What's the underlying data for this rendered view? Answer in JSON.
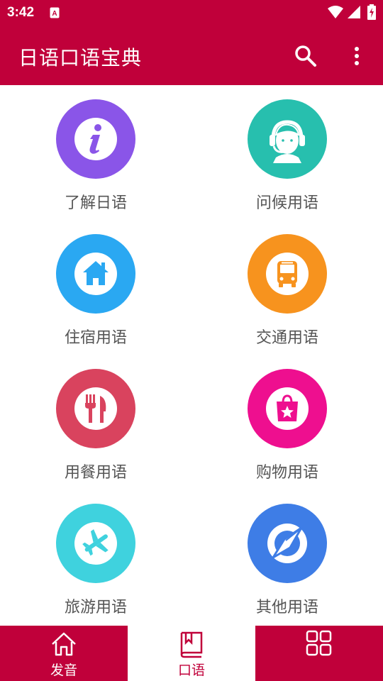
{
  "status_bar": {
    "time": "3:42",
    "icons": [
      "notification-a-icon",
      "wifi-icon",
      "signal-icon",
      "battery-charging-icon"
    ]
  },
  "app_bar": {
    "title": "日语口语宝典",
    "actions": [
      "search-icon",
      "more-vert-icon"
    ]
  },
  "categories": [
    {
      "label": "了解日语",
      "icon": "info-icon",
      "color": "#8a55e8"
    },
    {
      "label": "问候用语",
      "icon": "headset-operator-icon",
      "color": "#27bfae"
    },
    {
      "label": "住宿用语",
      "icon": "home-icon",
      "color": "#2aa8f2"
    },
    {
      "label": "交通用语",
      "icon": "bus-icon",
      "color": "#f7931e"
    },
    {
      "label": "用餐用语",
      "icon": "fork-knife-icon",
      "color": "#d9435e"
    },
    {
      "label": "购物用语",
      "icon": "shopping-bag-icon",
      "color": "#ee0f8f"
    },
    {
      "label": "旅游用语",
      "icon": "airplane-icon",
      "color": "#3fd2de"
    },
    {
      "label": "其他用语",
      "icon": "compass-icon",
      "color": "#3e7de6"
    }
  ],
  "bottom_nav": {
    "items": [
      {
        "label": "发音",
        "icon": "home-outline-icon",
        "selected": false
      },
      {
        "label": "口语",
        "icon": "book-icon",
        "selected": true
      },
      {
        "label": "",
        "icon": "grid-icon",
        "selected": false
      }
    ],
    "accent": "#c0003a"
  }
}
